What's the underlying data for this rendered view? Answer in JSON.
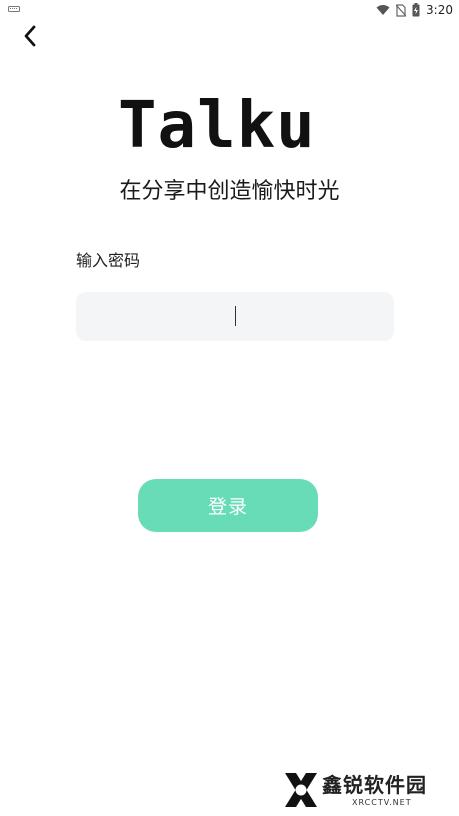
{
  "status_bar": {
    "time": "3:20",
    "icons": [
      "keyboard-icon",
      "wifi-icon",
      "no-sim-icon",
      "battery-charging-icon"
    ]
  },
  "header": {
    "back_icon": "chevron-left-icon"
  },
  "brand": {
    "app_name": "Talku",
    "tagline": "在分享中创造愉快时光"
  },
  "form": {
    "password_label": "输入密码",
    "password_value": "",
    "password_placeholder": ""
  },
  "actions": {
    "login_label": "登录"
  },
  "colors": {
    "accent": "#68dcb7",
    "input_bg": "#f4f5f7",
    "text": "#1a1a1a"
  },
  "watermark": {
    "name": "鑫锐软件园",
    "url": "XRCCTV.NET"
  }
}
